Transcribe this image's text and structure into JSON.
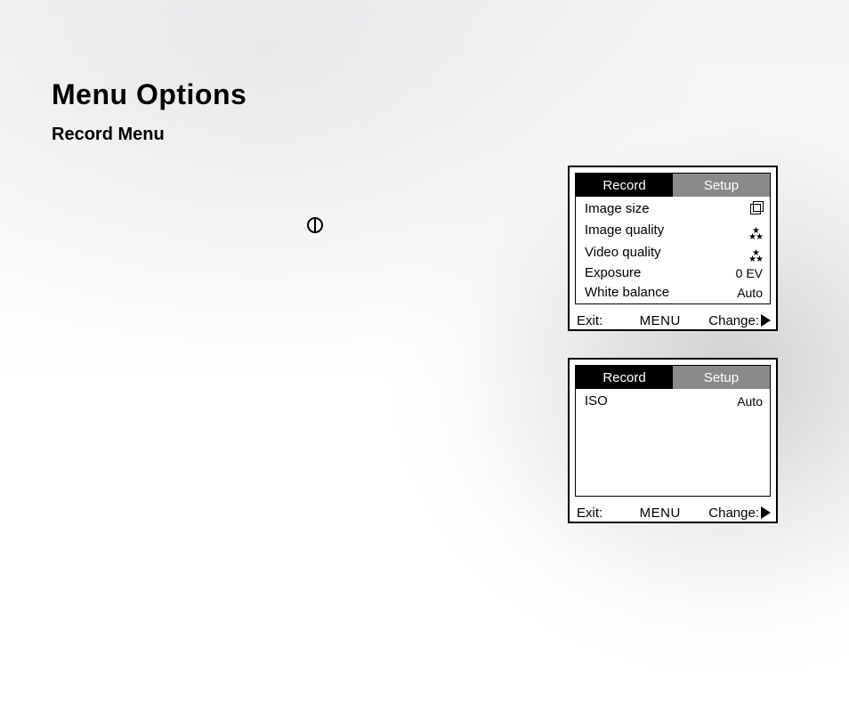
{
  "page": {
    "title": "Menu Options",
    "subtitle": "Record Menu"
  },
  "icons": {
    "power": "power-icon"
  },
  "panel1": {
    "tabs": {
      "record": "Record",
      "setup": "Setup",
      "active": "record"
    },
    "items": [
      {
        "label": "Image size",
        "value_icon": "imgsize"
      },
      {
        "label": "Image quality",
        "value_icon": "stars"
      },
      {
        "label": "Video quality",
        "value_icon": "stars"
      },
      {
        "label": "Exposure",
        "value_text": "0 EV"
      },
      {
        "label": "White balance",
        "value_text": "Auto"
      }
    ],
    "footer": {
      "exit": "Exit:",
      "menu": "MENU",
      "change": "Change:"
    }
  },
  "panel2": {
    "tabs": {
      "record": "Record",
      "setup": "Setup",
      "active": "record"
    },
    "items": [
      {
        "label": "ISO",
        "value_text": "Auto"
      }
    ],
    "footer": {
      "exit": "Exit:",
      "menu": "MENU",
      "change": "Change:"
    }
  }
}
